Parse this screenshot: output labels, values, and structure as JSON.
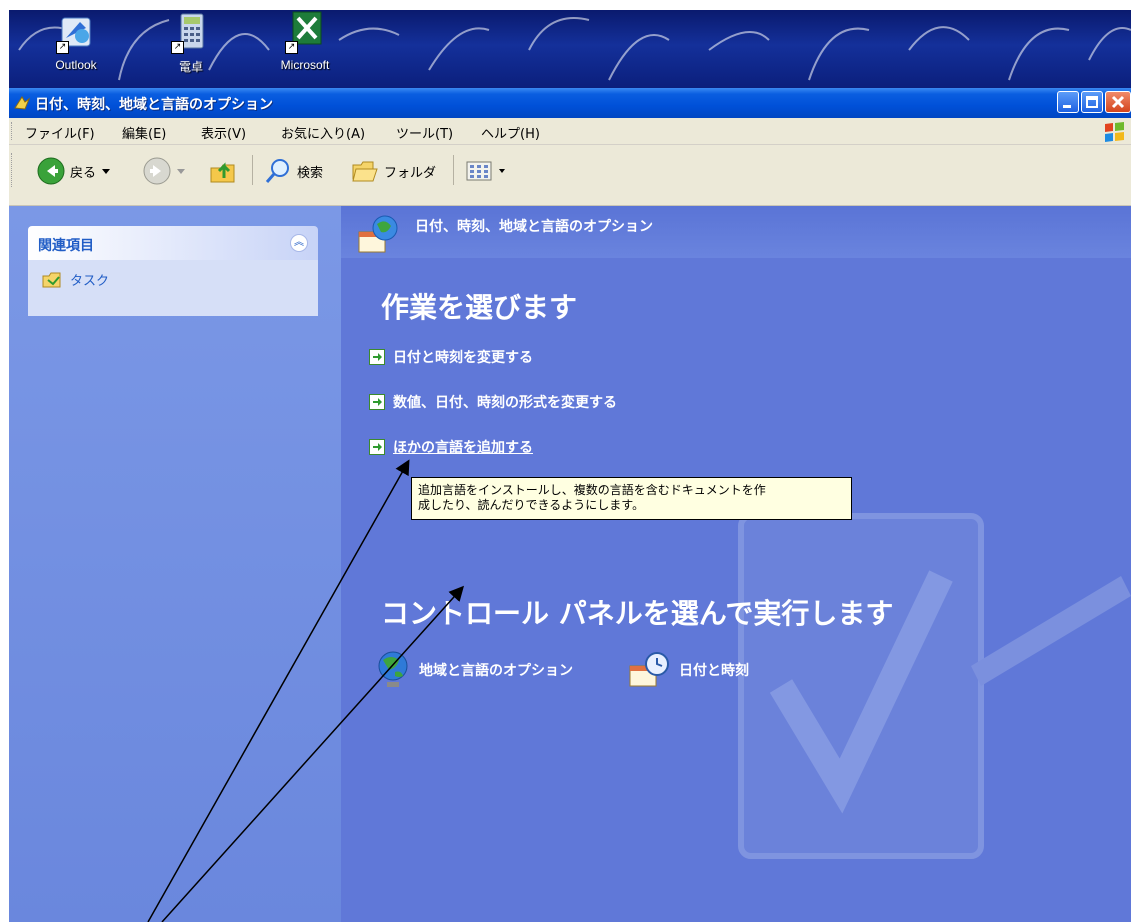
{
  "desktop": {
    "icons": [
      {
        "label": "Outlook",
        "icon": "outlook-express-icon"
      },
      {
        "label": "電卓",
        "icon": "calculator-icon"
      },
      {
        "label": "Microsoft",
        "icon": "excel-icon"
      }
    ]
  },
  "window": {
    "title": "日付、時刻、地域と言語のオプション",
    "controls": [
      "minimize-icon",
      "maximize-icon",
      "close-icon"
    ]
  },
  "menubar": {
    "items": [
      "ファイル(F)",
      "編集(E)",
      "表示(V)",
      "お気に入り(A)",
      "ツール(T)",
      "ヘルプ(H)"
    ]
  },
  "toolbar": {
    "back_label": "戻る",
    "search_label": "検索",
    "folders_label": "フォルダ"
  },
  "left_pane": {
    "panel_title": "関連項目",
    "task_label": "タスク"
  },
  "right_pane": {
    "header_title": "日付、時刻、地域と言語のオプション",
    "pick_task_title": "作業を選びます",
    "tasks": [
      "日付と時刻を変更する",
      "数値、日付、時刻の形式を変更する",
      "ほかの言語を追加する"
    ],
    "pick_cp_title": "コントロール パネルを選んで実行します",
    "cp_icons": [
      {
        "label": "地域と言語のオプション",
        "icon": "globe-icon"
      },
      {
        "label": "日付と時刻",
        "icon": "date-time-icon"
      }
    ]
  },
  "tooltip": {
    "line1": "追加言語をインストールし、複数の言語を含むドキュメントを作",
    "line2": "成したり、読んだりできるようにします。"
  },
  "colors": {
    "titlebar": "#0050d8",
    "pane_bg": "#6078d8",
    "menu_bg": "#ece9d8",
    "tooltip_bg": "#ffffe1"
  }
}
